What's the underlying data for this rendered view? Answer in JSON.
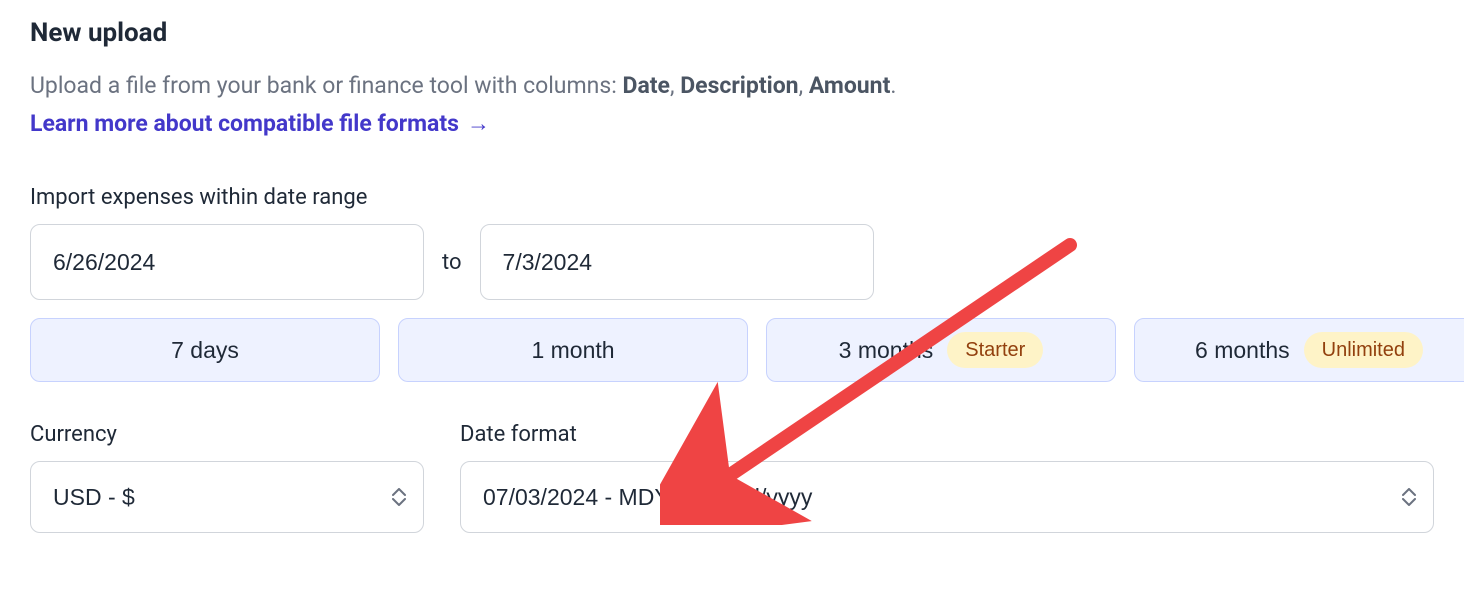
{
  "header": {
    "title": "New upload",
    "description_prefix": "Upload a file from your bank or finance tool with columns: ",
    "col1": "Date",
    "col2": "Description",
    "col3": "Amount",
    "description_suffix": ".",
    "link_label": "Learn more about compatible file formats"
  },
  "date_range": {
    "label": "Import expenses within date range",
    "from_value": "6/26/2024",
    "to_label": "to",
    "to_value": "7/3/2024"
  },
  "range_buttons": [
    {
      "label": "7 days",
      "badge": null
    },
    {
      "label": "1 month",
      "badge": null
    },
    {
      "label": "3 months",
      "badge": "Starter"
    },
    {
      "label": "6 months",
      "badge": "Unlimited"
    }
  ],
  "currency": {
    "label": "Currency",
    "value": "USD - $"
  },
  "date_format": {
    "label": "Date format",
    "value": "07/03/2024 - MDY - mm/dd/yyyy"
  },
  "annotation": {
    "arrow_color": "#ef4444"
  }
}
